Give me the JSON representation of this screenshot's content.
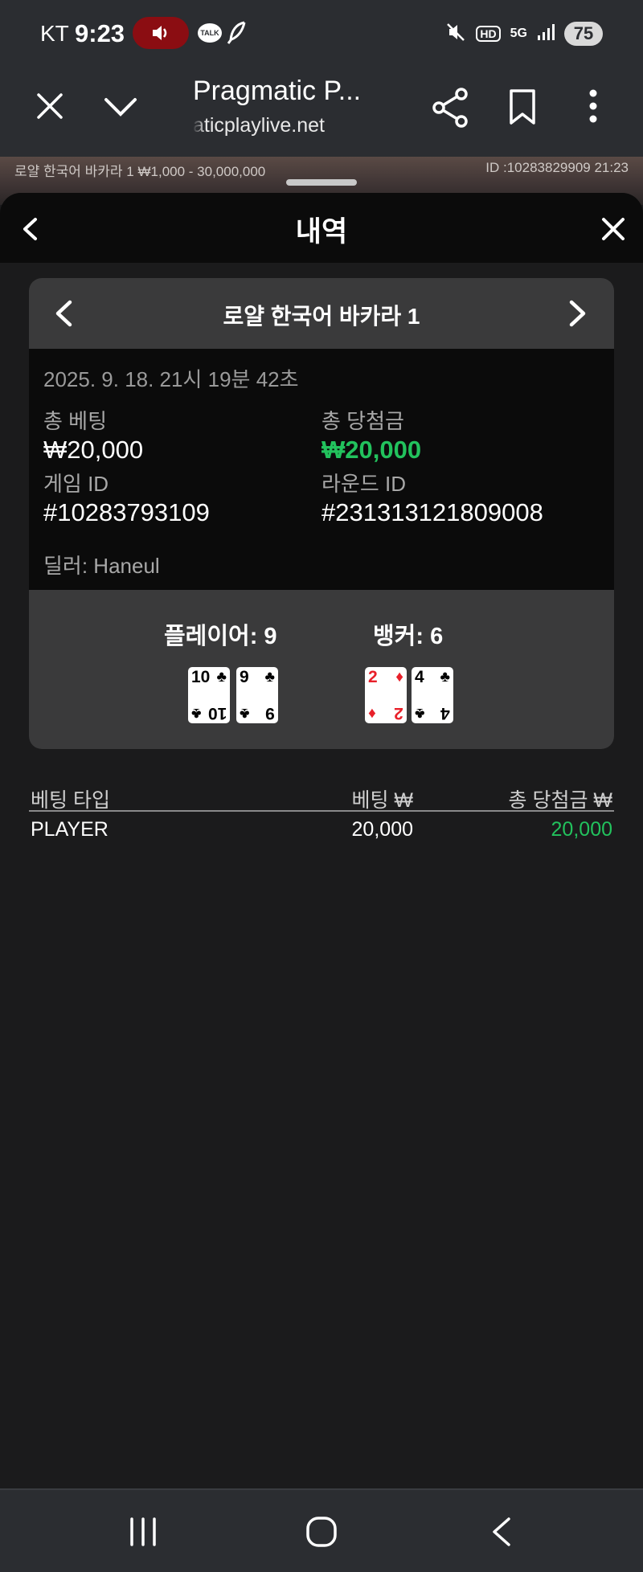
{
  "status_bar": {
    "carrier": "KT",
    "time": "9:23",
    "talk_badge": "TALK",
    "battery": "75",
    "icons": [
      "sound-on-icon",
      "kakaotalk-icon",
      "feather-icon",
      "mute-icon",
      "hd-icon",
      "5g-icon",
      "signal-icon",
      "battery-icon"
    ],
    "hd_label": "HD",
    "net_label": "5G"
  },
  "browser": {
    "title": "Pragmatic P...",
    "url": "aticplaylive.net"
  },
  "game_strip": {
    "left_text": "로얄 한국어 바카라 1 ₩1,000 - 30,000,000",
    "right_text": "ID :10283829909 21:23"
  },
  "sheet": {
    "title": "내역"
  },
  "card": {
    "table_name": "로얄 한국어 바카라 1",
    "datetime": "2025. 9. 18. 21시 19분 42초",
    "total_bet_label": "총 베팅",
    "total_bet_value": "₩20,000",
    "total_win_label": "총 당첨금",
    "total_win_value": "₩20,000",
    "game_id_label": "게임 ID",
    "game_id_value": "#10283793109",
    "round_id_label": "라운드 ID",
    "round_id_value": "#231313121809008",
    "dealer": "딜러: Haneul"
  },
  "result": {
    "player_label": "플레이어: 9",
    "banker_label": "뱅커: 6",
    "player_cards": [
      {
        "rank": "10",
        "suit": "♣",
        "color": "#000000"
      },
      {
        "rank": "9",
        "suit": "♣",
        "color": "#000000"
      }
    ],
    "banker_cards": [
      {
        "rank": "2",
        "suit": "♦",
        "color": "#e8202a"
      },
      {
        "rank": "4",
        "suit": "♣",
        "color": "#000000"
      }
    ]
  },
  "bets_table": {
    "headers": [
      "베팅 타입",
      "베팅 ₩",
      "총 당첨금 ₩"
    ],
    "rows": [
      [
        "PLAYER",
        "20,000",
        "20,000"
      ]
    ]
  },
  "colors": {
    "win_green": "#22c25d",
    "sound_pill": "#8b0d12",
    "header_bg": "#0b0b0b",
    "panel_bg": "#3a3a3b"
  }
}
